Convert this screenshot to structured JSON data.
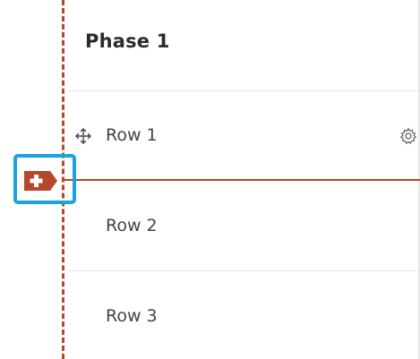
{
  "phase": {
    "title": "Phase 1"
  },
  "rows": [
    {
      "label": "Row 1"
    },
    {
      "label": "Row 2"
    },
    {
      "label": "Row 3"
    }
  ],
  "icons": {
    "move": "move-icon",
    "settings": "gear-icon",
    "add_row": "add-row-icon"
  },
  "colors": {
    "accent": "#b5472b",
    "focus": "#1aa3e0"
  }
}
